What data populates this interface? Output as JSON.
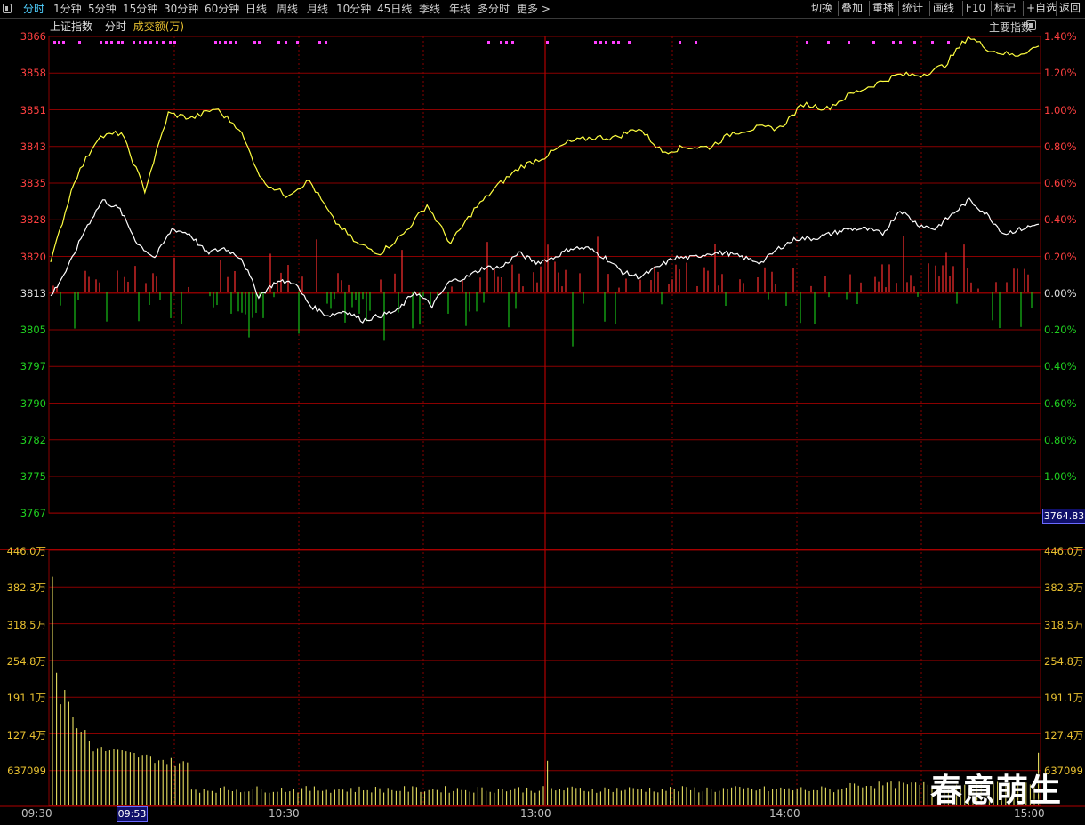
{
  "toolbar": {
    "tabs": [
      "分时",
      "1分钟",
      "5分钟",
      "15分钟",
      "30分钟",
      "60分钟",
      "日线",
      "周线",
      "月线",
      "10分钟",
      "45日线",
      "季线",
      "年线",
      "多分时",
      "更多 >"
    ],
    "active_tab": "分时",
    "right_buttons": [
      "切换",
      "叠加",
      "重播",
      "统计",
      "画线",
      "F10",
      "标记",
      "+自选",
      "返回"
    ]
  },
  "legend": {
    "index_name": "上证指数",
    "mode": "分时",
    "volume_label": "成交额(万)"
  },
  "major_index_label": "主要指数",
  "price_axis": {
    "left_labels": [
      "3866",
      "3858",
      "3851",
      "3843",
      "3835",
      "3828",
      "3820",
      "3813",
      "3805",
      "3797",
      "3790",
      "3782",
      "3775",
      "3767"
    ],
    "right_labels": [
      "1.40%",
      "1.20%",
      "1.00%",
      "0.80%",
      "0.60%",
      "0.40%",
      "0.20%",
      "0.00%",
      "0.20%",
      "0.40%",
      "0.60%",
      "0.80%",
      "1.00%"
    ],
    "prev_close": 3812.83,
    "price_range": [
      3767,
      3866
    ],
    "cursor_price": "3764.83"
  },
  "volume_axis": {
    "labels": [
      "446.0万",
      "382.3万",
      "318.5万",
      "254.8万",
      "191.1万",
      "127.4万",
      "637099"
    ],
    "max": 446.0
  },
  "time_axis": {
    "labels": [
      "09:30",
      "10:30",
      "13:00",
      "14:00",
      "15:00"
    ],
    "cursor_time": "09:53"
  },
  "colors": {
    "up": "#ff3030",
    "down": "#18c018",
    "index_line": "#ffffff",
    "avg_line": "#ffff40",
    "grid": "#8a0000",
    "signal": "#ff40ff"
  },
  "watermark": "春意萌生",
  "chart_data": {
    "type": "line",
    "x_labels": [
      "09:30",
      "10:30",
      "13:00",
      "14:00",
      "15:00"
    ],
    "series": [
      {
        "name": "上证指数",
        "color": "#ffffff",
        "values": [
          3812,
          3818,
          3826,
          3832,
          3830,
          3823,
          3820,
          3826,
          3825,
          3821,
          3822,
          3820,
          3812,
          3815,
          3815,
          3810,
          3808,
          3809,
          3807,
          3808,
          3809,
          3813,
          3810,
          3815,
          3816,
          3818,
          3818,
          3821,
          3819,
          3820,
          3822,
          3822,
          3820,
          3817,
          3816,
          3818,
          3820,
          3820,
          3821,
          3821,
          3820,
          3819,
          3822,
          3824,
          3824,
          3825,
          3826,
          3826,
          3825,
          3830,
          3827,
          3826,
          3829,
          3832,
          3829,
          3825,
          3826,
          3827
        ]
      },
      {
        "name": "成交额(万)",
        "color": "#ffff40",
        "values": [
          3819,
          3836,
          3845,
          3846,
          3834,
          3850,
          3849,
          3851,
          3847,
          3836,
          3833,
          3836,
          3828,
          3823,
          3821,
          3825,
          3831,
          3823,
          3830,
          3835,
          3839,
          3841,
          3844,
          3845,
          3845,
          3847,
          3842,
          3843,
          3843,
          3846,
          3847,
          3847,
          3852,
          3851,
          3854,
          3856,
          3858,
          3858,
          3860,
          3866,
          3863,
          3862,
          3864
        ]
      }
    ],
    "volume_bars_first": [
      400,
      232,
      177,
      202,
      181,
      155,
      135,
      129,
      132,
      112
    ],
    "ylim": [
      3767,
      3866
    ]
  }
}
